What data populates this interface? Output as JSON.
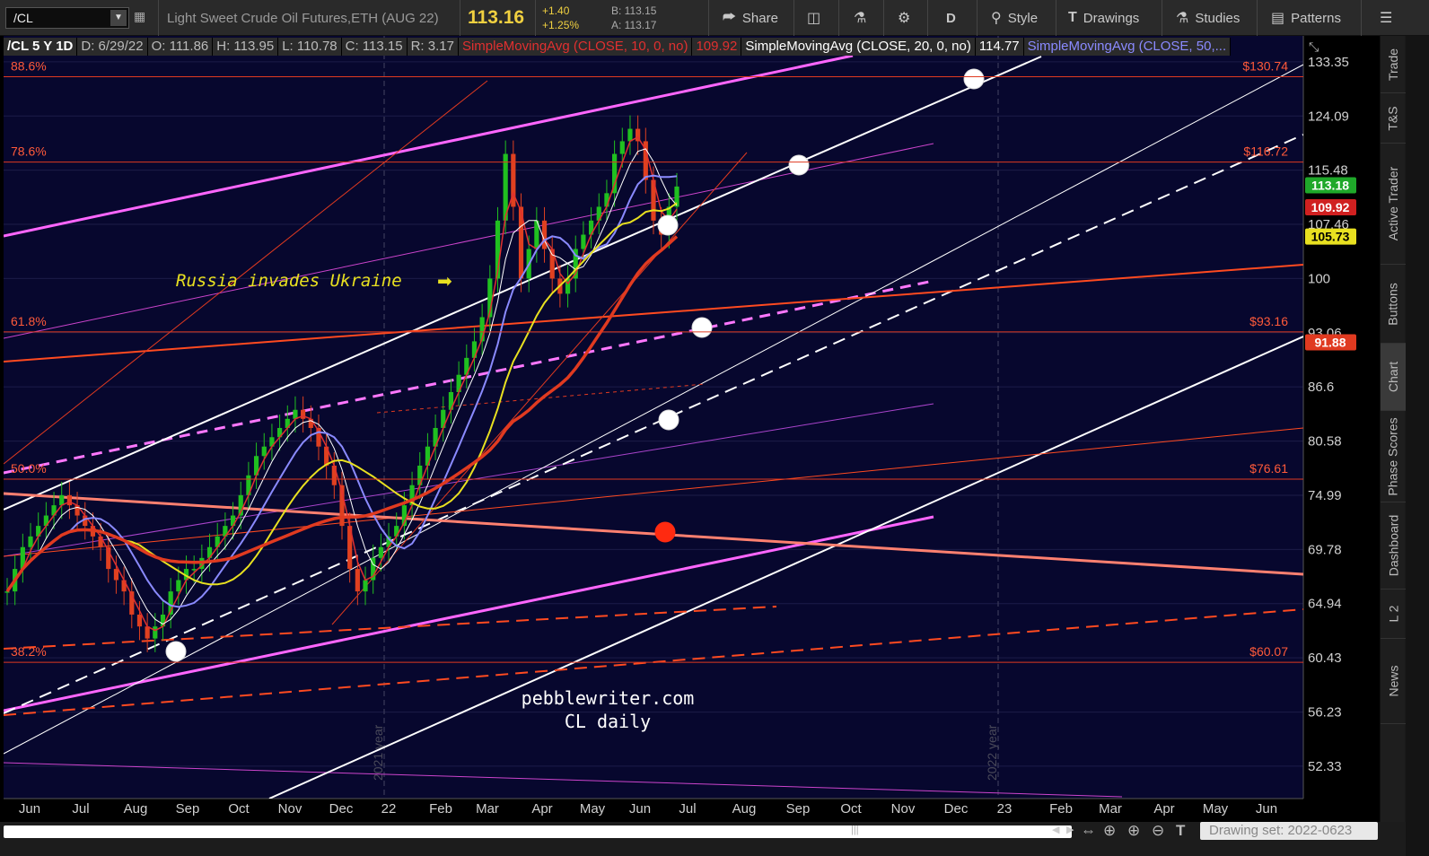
{
  "toolbar": {
    "symbol": "/CL",
    "description": "Light Sweet Crude Oil Futures,ETH (AUG 22)",
    "last_price": "113.16",
    "change_abs": "+1.40",
    "change_pct": "+1.25%",
    "bid": "B: 113.15",
    "ask": "A: 113.17",
    "share_label": "Share",
    "period_label": "D",
    "style_label": "Style",
    "drawings_label": "Drawings",
    "studies_label": "Studies",
    "patterns_label": "Patterns"
  },
  "info_row": {
    "symbol": "/CL 5 Y 1D",
    "date": "D: 6/29/22",
    "open": "O: 111.86",
    "high": "H: 113.95",
    "low": "L: 110.78",
    "close": "C: 113.15",
    "range": "R: 3.17",
    "sma10_label": "SimpleMovingAvg (CLOSE, 10, 0, no)",
    "sma10_value": "109.92",
    "sma20_label": "SimpleMovingAvg (CLOSE, 20, 0, no)",
    "sma20_value": "114.77",
    "sma50_label": "SimpleMovingAvg (CLOSE, 50,..."
  },
  "side_tabs": [
    "Trade",
    "T&S",
    "Active Trader",
    "Buttons",
    "Chart",
    "Phase Scores",
    "Dashboard",
    "L 2",
    "News"
  ],
  "side_tab_active": "Chart",
  "bottom": {
    "drawing_set": "Drawing set: 2022-0623"
  },
  "chart_data": {
    "type": "candlestick",
    "title": "/CL 5 Y 1D",
    "price_axis": {
      "ticks": [
        133.35,
        124.09,
        115.48,
        107.46,
        100,
        93.06,
        86.6,
        80.58,
        74.99,
        69.78,
        64.94,
        60.43,
        56.23,
        52.33
      ],
      "tick_labels": [
        "133.35",
        "124.09",
        "115.48",
        "107.46",
        "100",
        "93.06",
        "86.6",
        "80.58",
        "74.99",
        "69.78",
        "64.94",
        "60.43",
        "56.23",
        "52.33"
      ],
      "scale": "log",
      "range": [
        49.5,
        137
      ]
    },
    "time_axis": {
      "labels": [
        "Jun",
        "Jul",
        "Aug",
        "Sep",
        "Oct",
        "Nov",
        "Dec",
        "22",
        "Feb",
        "Mar",
        "Apr",
        "May",
        "Jun",
        "Jul",
        "Aug",
        "Sep",
        "Oct",
        "Nov",
        "Dec",
        "23",
        "Feb",
        "Mar",
        "Apr",
        "May",
        "Jun"
      ],
      "year_markers": [
        "2021 year",
        "2022 year"
      ]
    },
    "fib_levels": [
      {
        "pct": "88.6%",
        "price": 130.74,
        "label": "$130.74"
      },
      {
        "pct": "78.6%",
        "price": 116.72,
        "label": "$116.72"
      },
      {
        "pct": "61.8%",
        "price": 93.16,
        "label": "$93.16"
      },
      {
        "pct": "50.0%",
        "price": 76.61,
        "label": "$76.61"
      },
      {
        "pct": "38.2%",
        "price": 60.07,
        "label": "$60.07"
      }
    ],
    "price_badges": [
      {
        "value": "113.18",
        "color": "#1fa82a"
      },
      {
        "value": "109.92",
        "color": "#d02020"
      },
      {
        "value": "105.73",
        "color": "#e8e020"
      },
      {
        "value": "91.88",
        "color": "#e03a20"
      }
    ],
    "series": [
      {
        "name": "SimpleMovingAvg (CLOSE, 10, 0, no)",
        "color": "#e03030",
        "last": 109.92
      },
      {
        "name": "SimpleMovingAvg (CLOSE, 20, 0, no)",
        "color": "#ffffff",
        "last": 114.77
      },
      {
        "name": "SimpleMovingAvg (CLOSE, 50,...",
        "color": "#8a8aff",
        "last": 105.73
      },
      {
        "color": "#e8e020",
        "last": 105.73
      },
      {
        "color": "#e03a20",
        "last": 91.88
      }
    ],
    "closes": [
      66,
      68,
      70,
      71,
      72,
      73,
      74,
      75,
      74,
      73,
      72,
      71,
      70,
      68,
      67,
      66,
      64,
      63,
      62,
      63,
      64,
      66,
      67,
      68,
      68,
      69,
      70,
      71,
      72,
      73,
      75,
      77,
      79,
      80,
      81,
      82,
      83,
      84,
      83,
      82,
      80,
      78,
      76,
      72,
      68,
      66,
      67,
      69,
      70,
      71,
      72,
      74,
      76,
      78,
      80,
      82,
      84,
      86,
      88,
      90,
      92,
      95,
      100,
      108,
      118,
      110,
      100,
      104,
      108,
      104,
      100,
      98,
      100,
      104,
      106,
      108,
      110,
      112,
      118,
      120,
      122,
      120,
      114,
      108,
      106,
      110,
      113
    ],
    "annotations": [
      {
        "text": "Russia invades Ukraine",
        "color": "#e8e020"
      },
      {
        "text": "pebblewriter.com",
        "color": "#ffffff"
      },
      {
        "text": "CL daily",
        "color": "#ffffff"
      }
    ]
  }
}
